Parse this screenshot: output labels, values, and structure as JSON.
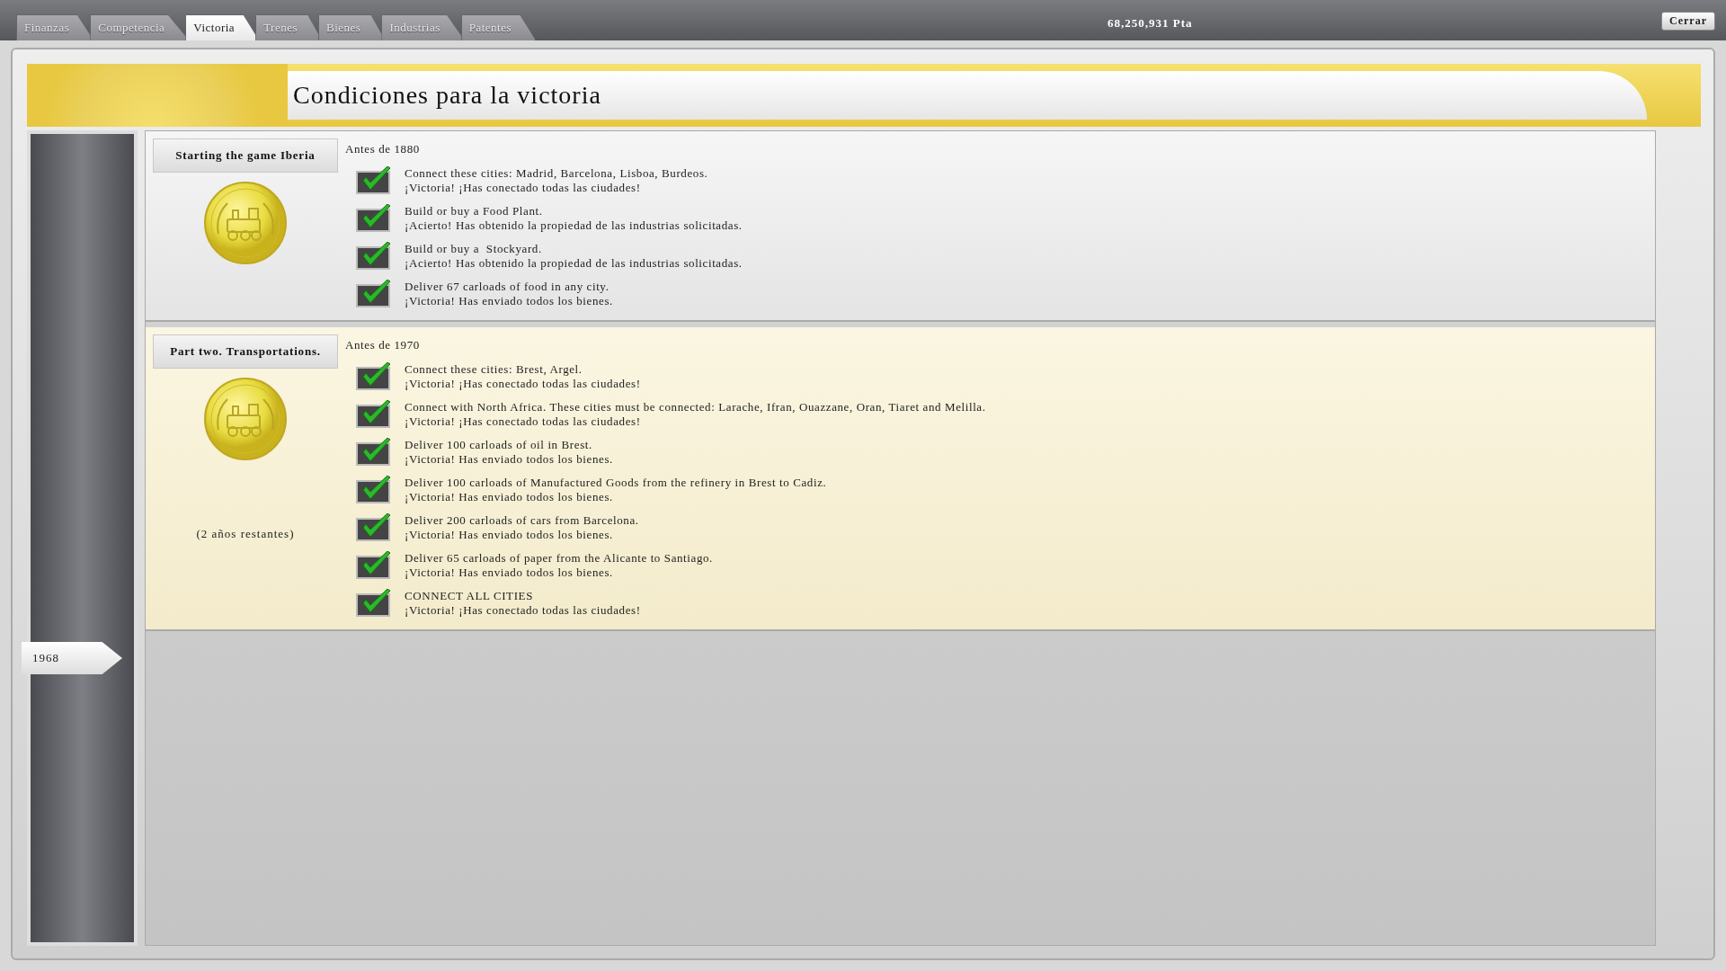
{
  "tabs": [
    {
      "label": "Finanzas",
      "selected": false
    },
    {
      "label": "Competencia",
      "selected": false
    },
    {
      "label": "Victoria",
      "selected": true
    },
    {
      "label": "Trenes",
      "selected": false
    },
    {
      "label": "Bienes",
      "selected": false
    },
    {
      "label": "Industrias",
      "selected": false
    },
    {
      "label": "Patentes",
      "selected": false
    }
  ],
  "balance": "68,250,931 Pta",
  "close_button": "Cerrar",
  "title": "Condiciones para la victoria",
  "timeline": {
    "year": "1968"
  },
  "scenarios": [
    {
      "title": "Starting the game Iberia",
      "deadline": "Antes de 1880",
      "active": false,
      "goals": [
        {
          "text": "Connect these cities: Madrid, Barcelona, Lisboa, Burdeos.",
          "result": "¡Victoria! ¡Has conectado todas las ciudades!",
          "completed": true
        },
        {
          "text": "Build or buy a Food Plant.",
          "result": "¡Acierto! Has obtenido la propiedad de las industrias solicitadas.",
          "completed": true
        },
        {
          "text": "Build or buy a  Stockyard.",
          "result": "¡Acierto! Has obtenido la propiedad de las industrias solicitadas.",
          "completed": true
        },
        {
          "text": "Deliver 67 carloads of food in any city.",
          "result": "¡Victoria! Has enviado todos los bienes.",
          "completed": true
        }
      ]
    },
    {
      "title": "Part two. Transportations.",
      "deadline": "Antes de 1970",
      "time_left": "(2 años restantes)",
      "active": true,
      "goals": [
        {
          "text": "Connect these cities: Brest, Argel.",
          "result": "¡Victoria! ¡Has conectado todas las ciudades!",
          "completed": true
        },
        {
          "text": "Connect with North Africa. These cities must be connected: Larache, Ifran, Ouazzane, Oran, Tiaret and Melilla.",
          "result": "¡Victoria! ¡Has conectado todas las ciudades!",
          "completed": true
        },
        {
          "text": "Deliver 100 carloads of oil in Brest.",
          "result": "¡Victoria! Has enviado todos los bienes.",
          "completed": true
        },
        {
          "text": "Deliver 100 carloads of Manufactured Goods from the refinery in Brest to Cadiz.",
          "result": "¡Victoria! Has enviado todos los bienes.",
          "completed": true
        },
        {
          "text": "Deliver 200 carloads of cars from Barcelona.",
          "result": "¡Victoria! Has enviado todos los bienes.",
          "completed": true
        },
        {
          "text": "Deliver 65 carloads of paper from the Alicante to Santiago.",
          "result": "¡Victoria! Has enviado todos los bienes.",
          "completed": true
        },
        {
          "text": "CONNECT ALL CITIES",
          "result": "¡Victoria! ¡Has conectado todas las ciudades!",
          "completed": true
        }
      ]
    }
  ]
}
